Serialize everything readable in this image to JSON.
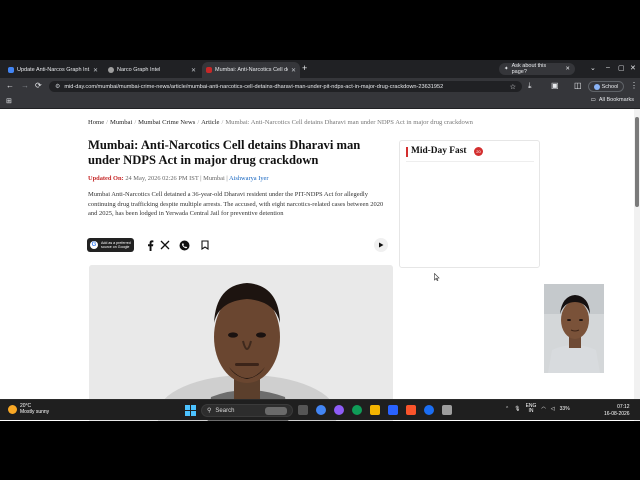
{
  "browser": {
    "tabs": [
      {
        "title": "Update Anti-Narcos Graph Int…",
        "active": false
      },
      {
        "title": "Narco Graph Intel",
        "active": false
      },
      {
        "title": "Mumbai: Anti-Narcotics Cell de…",
        "active": true
      }
    ],
    "ask_label": "Ask about this page?",
    "url": "mid-day.com/mumbai/mumbai-crime-news/article/mumbai-anti-narcotics-cell-detains-dharavi-man-under-pit-ndps-act-in-major-drug-crackdown-23631952",
    "profile_label": "School",
    "all_bookmarks": "All Bookmarks"
  },
  "article": {
    "breadcrumb": [
      {
        "label": "Home"
      },
      {
        "label": "Mumbai"
      },
      {
        "label": "Mumbai Crime News"
      },
      {
        "label": "Article"
      },
      {
        "label": "Mumbai: Anti-Narcotics Cell detains Dharavi man under NDPS Act in major drug crackdown"
      }
    ],
    "headline": "Mumbai: Anti-Narcotics Cell detains Dharavi man under NDPS Act in major drug crackdown",
    "updated_label": "Updated On:",
    "updated_date": "24 May, 2026 02:26 PM IST",
    "section": "Mumbai",
    "author": "Aishwarya Iyer",
    "summary": "Mumbai Anti-Narcotics Cell detained a 36-year-old Dharavi resident under the PIT-NDPS Act for allegedly continuing drug trafficking despite multiple arrests. The accused, with eight narcotics-related cases between 2020 and 2025, has been lodged in Yerwada Central Jail for preventive detention",
    "google_badge": {
      "line1": "Add as a preferred",
      "line2": "source on Google"
    }
  },
  "sidebar": {
    "title": "Mid-Day Fast",
    "badge": "20"
  },
  "taskbar": {
    "weather_temp": "20°C",
    "weather_desc": "Mostly sunny",
    "search_placeholder": "Search",
    "lang_top": "ENG",
    "lang_bottom": "IN",
    "battery": "33%",
    "time": "07:12",
    "date": "16-08-2026"
  },
  "colors": {
    "accent_red": "#d32f2f",
    "author_blue": "#1565c0",
    "chrome_dark": "#202124"
  }
}
